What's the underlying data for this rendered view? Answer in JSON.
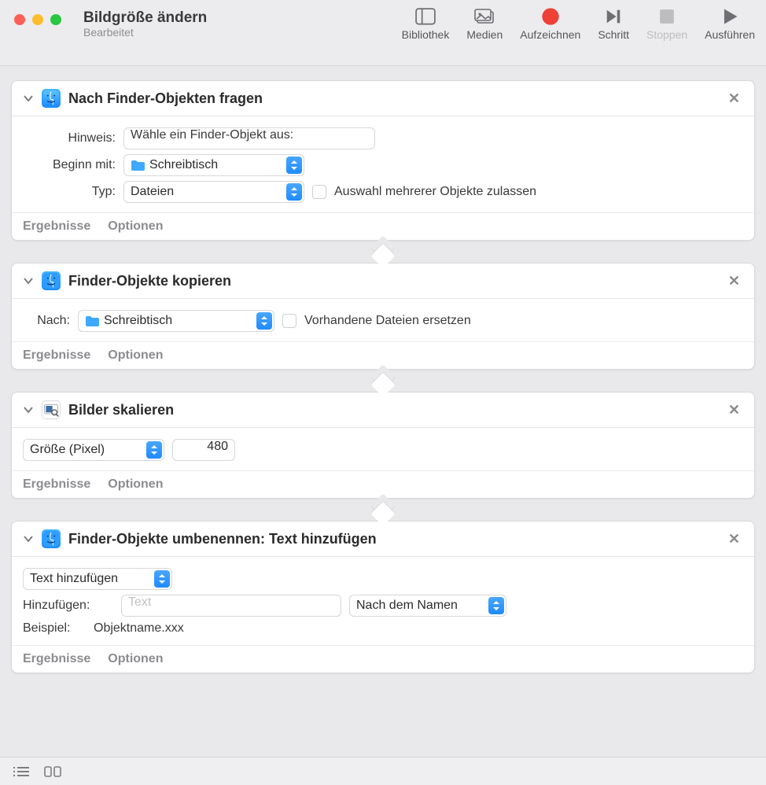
{
  "window": {
    "title": "Bildgröße ändern",
    "subtitle": "Bearbeitet"
  },
  "toolbar": {
    "library": "Bibliothek",
    "media": "Medien",
    "record": "Aufzeichnen",
    "step": "Schritt",
    "stop": "Stoppen",
    "run": "Ausführen"
  },
  "common": {
    "results": "Ergebnisse",
    "options": "Optionen",
    "close_x": "✕"
  },
  "actions": [
    {
      "title": "Nach Finder-Objekten fragen",
      "rows": {
        "hint_label": "Hinweis:",
        "hint_value": "Wähle ein Finder-Objekt aus:",
        "start_label": "Beginn mit:",
        "start_value": "Schreibtisch",
        "type_label": "Typ:",
        "type_value": "Dateien",
        "multi_label": "Auswahl mehrerer Objekte zulassen"
      }
    },
    {
      "title": "Finder-Objekte kopieren",
      "rows": {
        "to_label": "Nach:",
        "to_value": "Schreibtisch",
        "replace_label": "Vorhandene Dateien ersetzen"
      }
    },
    {
      "title": "Bilder skalieren",
      "rows": {
        "mode_value": "Größe (Pixel)",
        "size_value": "480"
      }
    },
    {
      "title": "Finder-Objekte umbenennen: Text hinzufügen",
      "rows": {
        "op_value": "Text hinzufügen",
        "add_label": "Hinzufügen:",
        "add_placeholder": "Text",
        "pos_value": "Nach dem Namen",
        "example_label": "Beispiel:",
        "example_value": "Objektname.xxx"
      }
    }
  ]
}
